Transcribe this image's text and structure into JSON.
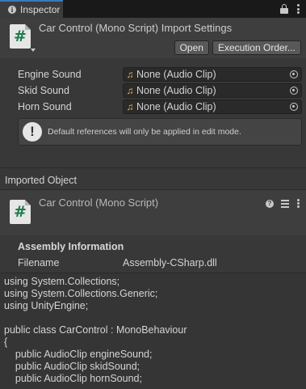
{
  "tab": {
    "title": "Inspector"
  },
  "header": {
    "title": "Car Control (Mono Script) Import Settings",
    "icon_glyph": "#",
    "buttons": {
      "open": "Open",
      "execution_order": "Execution Order..."
    }
  },
  "properties": [
    {
      "label": "Engine Sound",
      "value": "None (Audio Clip)"
    },
    {
      "label": "Skid Sound",
      "value": "None (Audio Clip)"
    },
    {
      "label": "Horn Sound",
      "value": "None (Audio Clip)"
    }
  ],
  "helpbox": {
    "text": "Default references will only be applied in edit mode."
  },
  "imported_object": {
    "section_label": "Imported Object",
    "title": "Car Control (Mono Script)",
    "icon_glyph": "#"
  },
  "assembly": {
    "title": "Assembly Information",
    "filename_label": "Filename",
    "filename_value": "Assembly-CSharp.dll"
  },
  "code_lines": [
    "using System.Collections;",
    "using System.Collections.Generic;",
    "using UnityEngine;",
    "",
    "public class CarControl : MonoBehaviour",
    "{",
    "    public AudioClip engineSound;",
    "    public AudioClip skidSound;",
    "    public AudioClip hornSound;"
  ],
  "colors": {
    "panel_bg": "#383838",
    "header_bg": "#3e3e3e",
    "tab_accent": "#3a79bb",
    "audio_icon": "#e3c042",
    "script_icon_glyph": "#1d7a4a"
  }
}
